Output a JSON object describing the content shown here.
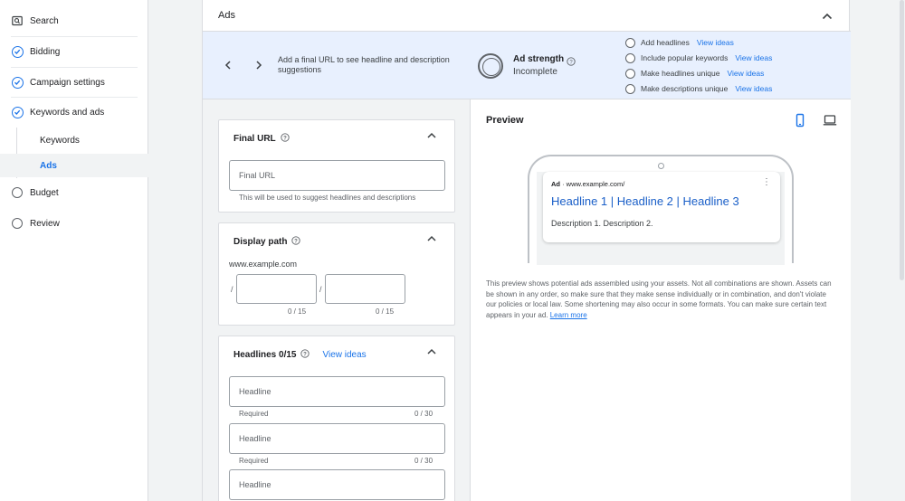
{
  "sidebar": {
    "items": [
      {
        "label": "Search",
        "icon": "search-campaign-icon"
      },
      {
        "label": "Bidding",
        "icon": "check-circle-icon"
      },
      {
        "label": "Campaign settings",
        "icon": "check-circle-icon"
      },
      {
        "label": "Keywords and ads",
        "icon": "check-circle-icon"
      },
      {
        "label": "Budget",
        "icon": "empty-circle-icon"
      },
      {
        "label": "Review",
        "icon": "empty-circle-icon"
      }
    ],
    "sub_items": [
      {
        "label": "Keywords",
        "active": false
      },
      {
        "label": "Ads",
        "active": true
      }
    ]
  },
  "card": {
    "title": "Ads"
  },
  "banner": {
    "message": "Add a final URL to see headline and description suggestions",
    "strength_title": "Ad strength",
    "strength_status": "Incomplete",
    "tips": [
      {
        "label": "Add headlines",
        "link": "View ideas"
      },
      {
        "label": "Include popular keywords",
        "link": "View ideas"
      },
      {
        "label": "Make headlines unique",
        "link": "View ideas"
      },
      {
        "label": "Make descriptions unique",
        "link": "View ideas"
      }
    ]
  },
  "final_url": {
    "title": "Final URL",
    "placeholder": "Final URL",
    "helper": "This will be used to suggest headlines and descriptions"
  },
  "display_path": {
    "title": "Display path",
    "domain": "www.example.com",
    "slash": "/",
    "path1_count": "0 / 15",
    "path2_count": "0 / 15"
  },
  "headlines": {
    "title": "Headlines 0/15",
    "view_ideas": "View ideas",
    "placeholder": "Headline",
    "required": "Required",
    "count": "0 / 30"
  },
  "preview": {
    "title": "Preview",
    "ad_label": "Ad",
    "ad_url": "· www.example.com/",
    "headline": "Headline 1 | Headline 2 | Headline 3",
    "description": "Description 1. Description 2.",
    "note": "This preview shows potential ads assembled using your assets. Not all combinations are shown. Assets can be shown in any order, so make sure that they make sense individually or in combination, and don't violate our policies or local law. Some shortening may also occur in some formats. You can make sure certain text appears in your ad.",
    "learn_more": "Learn more"
  },
  "colors": {
    "accent": "#1a73e8",
    "banner_bg": "#e8f0fe",
    "page_bg": "#f1f3f4"
  }
}
